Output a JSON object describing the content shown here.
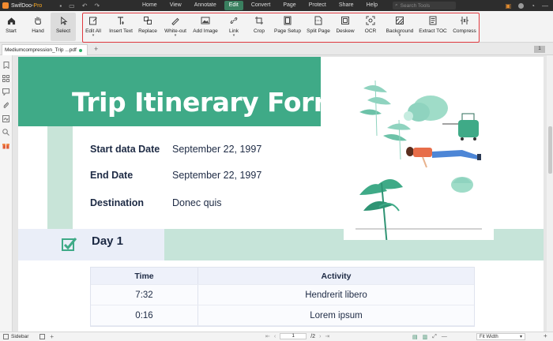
{
  "app": {
    "name": "SwifDoo",
    "edition": "Pro"
  },
  "menu": [
    "Home",
    "View",
    "Annotate",
    "Edit",
    "Convert",
    "Page",
    "Protect",
    "Share",
    "Help"
  ],
  "menu_active": "Edit",
  "search": {
    "placeholder": "Search Tools"
  },
  "toolbar": {
    "start": "Start",
    "hand": "Hand",
    "select": "Select",
    "edit_all": "Edit All",
    "insert_text": "Insert Text",
    "replace": "Replace",
    "white_out": "White-out",
    "add_image": "Add Image",
    "link": "Link",
    "crop": "Crop",
    "page_setup": "Page Setup",
    "split_page": "Split Page",
    "deskew": "Deskew",
    "ocr": "OCR",
    "background": "Background",
    "extract_toc": "Extract TOC",
    "compress": "Compress"
  },
  "highlight_color": "#e0393f",
  "tab": {
    "filename": "Mediumcompression_Trip ...pdf",
    "page_indicator": "1"
  },
  "document": {
    "title": "Trip Itinerary Form",
    "fields": [
      {
        "label": "Start data Date",
        "value": "September 22, 1997"
      },
      {
        "label": "End Date",
        "value": "September 22, 1997"
      },
      {
        "label": "Destination",
        "value": "Donec quis"
      }
    ],
    "day_label": "Day 1",
    "table": {
      "headers": [
        "Time",
        "Activity"
      ],
      "rows": [
        {
          "time": "7:32",
          "activity": "Hendrerit libero"
        },
        {
          "time": "0:16",
          "activity": "Lorem ipsum"
        }
      ]
    },
    "colors": {
      "header_green": "#3faa87",
      "light_green": "#c6e4d9",
      "lavender": "#eaeef8",
      "navy_text": "#1d2a44"
    }
  },
  "status": {
    "sidebar_label": "Sidebar",
    "current_page": "1",
    "total_pages": "/2",
    "zoom": "Fit Width"
  }
}
